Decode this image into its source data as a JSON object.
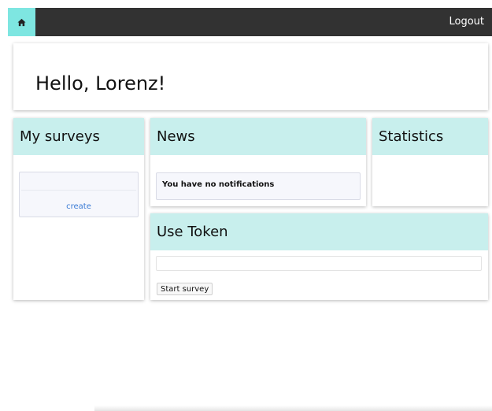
{
  "topbar": {
    "home_icon": "home-icon",
    "logout_label": "Logout",
    "bar_color": "#323232",
    "accent_color": "#7ee6e1"
  },
  "greeting": {
    "text": "Hello, Lorenz!"
  },
  "surveys": {
    "title": "My surveys",
    "create_label": "create"
  },
  "news": {
    "title": "News",
    "message": "You have no notifications"
  },
  "statistics": {
    "title": "Statistics"
  },
  "token": {
    "title": "Use Token",
    "input_value": "",
    "start_label": "Start survey"
  },
  "colors": {
    "card_header": "#c8efed",
    "link": "#3a7bd5"
  }
}
